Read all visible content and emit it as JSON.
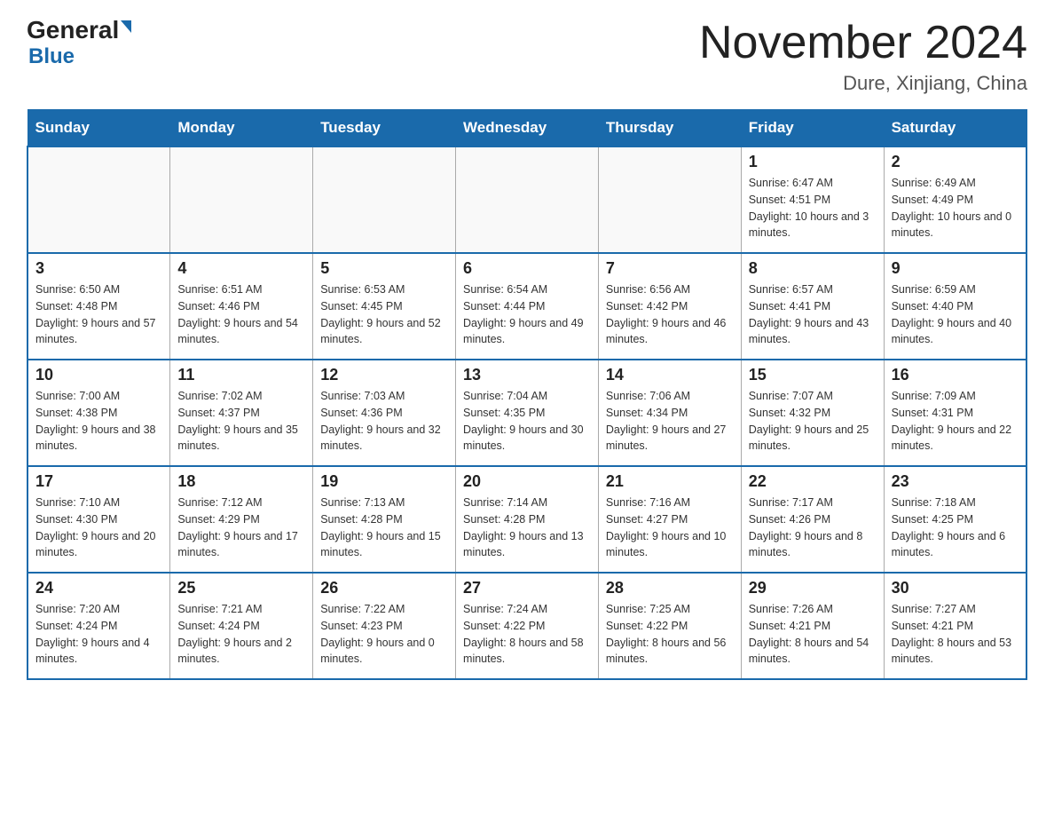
{
  "header": {
    "logo_general": "General",
    "logo_blue": "Blue",
    "month_title": "November 2024",
    "location": "Dure, Xinjiang, China"
  },
  "days_of_week": [
    "Sunday",
    "Monday",
    "Tuesday",
    "Wednesday",
    "Thursday",
    "Friday",
    "Saturday"
  ],
  "weeks": [
    [
      {
        "day": "",
        "info": ""
      },
      {
        "day": "",
        "info": ""
      },
      {
        "day": "",
        "info": ""
      },
      {
        "day": "",
        "info": ""
      },
      {
        "day": "",
        "info": ""
      },
      {
        "day": "1",
        "info": "Sunrise: 6:47 AM\nSunset: 4:51 PM\nDaylight: 10 hours and 3 minutes."
      },
      {
        "day": "2",
        "info": "Sunrise: 6:49 AM\nSunset: 4:49 PM\nDaylight: 10 hours and 0 minutes."
      }
    ],
    [
      {
        "day": "3",
        "info": "Sunrise: 6:50 AM\nSunset: 4:48 PM\nDaylight: 9 hours and 57 minutes."
      },
      {
        "day": "4",
        "info": "Sunrise: 6:51 AM\nSunset: 4:46 PM\nDaylight: 9 hours and 54 minutes."
      },
      {
        "day": "5",
        "info": "Sunrise: 6:53 AM\nSunset: 4:45 PM\nDaylight: 9 hours and 52 minutes."
      },
      {
        "day": "6",
        "info": "Sunrise: 6:54 AM\nSunset: 4:44 PM\nDaylight: 9 hours and 49 minutes."
      },
      {
        "day": "7",
        "info": "Sunrise: 6:56 AM\nSunset: 4:42 PM\nDaylight: 9 hours and 46 minutes."
      },
      {
        "day": "8",
        "info": "Sunrise: 6:57 AM\nSunset: 4:41 PM\nDaylight: 9 hours and 43 minutes."
      },
      {
        "day": "9",
        "info": "Sunrise: 6:59 AM\nSunset: 4:40 PM\nDaylight: 9 hours and 40 minutes."
      }
    ],
    [
      {
        "day": "10",
        "info": "Sunrise: 7:00 AM\nSunset: 4:38 PM\nDaylight: 9 hours and 38 minutes."
      },
      {
        "day": "11",
        "info": "Sunrise: 7:02 AM\nSunset: 4:37 PM\nDaylight: 9 hours and 35 minutes."
      },
      {
        "day": "12",
        "info": "Sunrise: 7:03 AM\nSunset: 4:36 PM\nDaylight: 9 hours and 32 minutes."
      },
      {
        "day": "13",
        "info": "Sunrise: 7:04 AM\nSunset: 4:35 PM\nDaylight: 9 hours and 30 minutes."
      },
      {
        "day": "14",
        "info": "Sunrise: 7:06 AM\nSunset: 4:34 PM\nDaylight: 9 hours and 27 minutes."
      },
      {
        "day": "15",
        "info": "Sunrise: 7:07 AM\nSunset: 4:32 PM\nDaylight: 9 hours and 25 minutes."
      },
      {
        "day": "16",
        "info": "Sunrise: 7:09 AM\nSunset: 4:31 PM\nDaylight: 9 hours and 22 minutes."
      }
    ],
    [
      {
        "day": "17",
        "info": "Sunrise: 7:10 AM\nSunset: 4:30 PM\nDaylight: 9 hours and 20 minutes."
      },
      {
        "day": "18",
        "info": "Sunrise: 7:12 AM\nSunset: 4:29 PM\nDaylight: 9 hours and 17 minutes."
      },
      {
        "day": "19",
        "info": "Sunrise: 7:13 AM\nSunset: 4:28 PM\nDaylight: 9 hours and 15 minutes."
      },
      {
        "day": "20",
        "info": "Sunrise: 7:14 AM\nSunset: 4:28 PM\nDaylight: 9 hours and 13 minutes."
      },
      {
        "day": "21",
        "info": "Sunrise: 7:16 AM\nSunset: 4:27 PM\nDaylight: 9 hours and 10 minutes."
      },
      {
        "day": "22",
        "info": "Sunrise: 7:17 AM\nSunset: 4:26 PM\nDaylight: 9 hours and 8 minutes."
      },
      {
        "day": "23",
        "info": "Sunrise: 7:18 AM\nSunset: 4:25 PM\nDaylight: 9 hours and 6 minutes."
      }
    ],
    [
      {
        "day": "24",
        "info": "Sunrise: 7:20 AM\nSunset: 4:24 PM\nDaylight: 9 hours and 4 minutes."
      },
      {
        "day": "25",
        "info": "Sunrise: 7:21 AM\nSunset: 4:24 PM\nDaylight: 9 hours and 2 minutes."
      },
      {
        "day": "26",
        "info": "Sunrise: 7:22 AM\nSunset: 4:23 PM\nDaylight: 9 hours and 0 minutes."
      },
      {
        "day": "27",
        "info": "Sunrise: 7:24 AM\nSunset: 4:22 PM\nDaylight: 8 hours and 58 minutes."
      },
      {
        "day": "28",
        "info": "Sunrise: 7:25 AM\nSunset: 4:22 PM\nDaylight: 8 hours and 56 minutes."
      },
      {
        "day": "29",
        "info": "Sunrise: 7:26 AM\nSunset: 4:21 PM\nDaylight: 8 hours and 54 minutes."
      },
      {
        "day": "30",
        "info": "Sunrise: 7:27 AM\nSunset: 4:21 PM\nDaylight: 8 hours and 53 minutes."
      }
    ]
  ]
}
